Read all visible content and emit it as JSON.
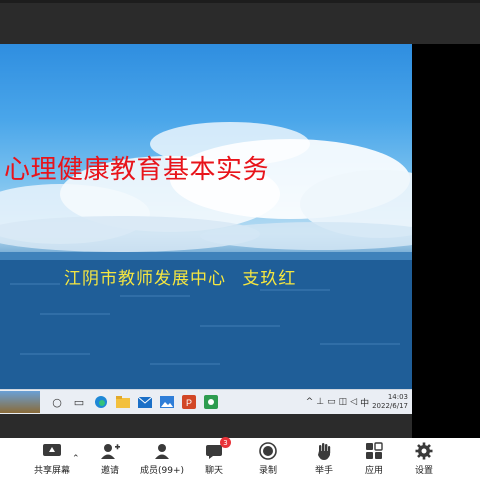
{
  "slide": {
    "title": "心理健康教育基本实务",
    "subtitle": "江阴市教师发展中心   支玖红"
  },
  "taskbar": {
    "time": "14:03",
    "date": "2022/6/17"
  },
  "toolbar": {
    "share_screen": "共享屏幕",
    "invite": "邀请",
    "participants": "成员(99+)",
    "chat": "聊天",
    "chat_badge": "3",
    "record": "录制",
    "raise_hand": "举手",
    "apps": "应用",
    "settings": "设置"
  }
}
